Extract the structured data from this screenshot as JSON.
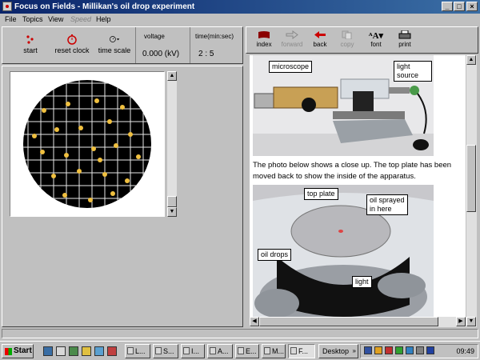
{
  "window": {
    "title": "Focus on Fields - Millikan's oil drop experiment",
    "controls": [
      "_",
      "□",
      "×"
    ]
  },
  "menu": [
    "File",
    "Topics",
    "View",
    "Speed",
    "Help"
  ],
  "left_toolbar": {
    "start": "start",
    "reset_clock": "reset clock",
    "time_scale": "time scale",
    "voltage_label": "voltage",
    "voltage_value": "0.000  (kV)",
    "time_label": "time(min:sec)",
    "time_value": "2 : 5"
  },
  "right_toolbar": {
    "index": "index",
    "forward": "forward",
    "back": "back",
    "copy": "copy",
    "font": "font",
    "print": "print"
  },
  "content": {
    "callout_microscope": "microscope",
    "callout_light_source": "light\nsource",
    "paragraph": "The photo below shows a close up. The top plate has been moved back to show the inside of the apparatus.",
    "callout_top_plate": "top plate",
    "callout_oil_sprayed": "oil sprayed\nin here",
    "callout_oil_drops": "oil drops",
    "callout_light": "light"
  },
  "taskbar": {
    "start": "Start",
    "tasks": [
      "L...",
      "S...",
      "I...",
      "A...",
      "E...",
      "M...",
      "F..."
    ],
    "desktop": "Desktop",
    "clock": "09:49"
  }
}
